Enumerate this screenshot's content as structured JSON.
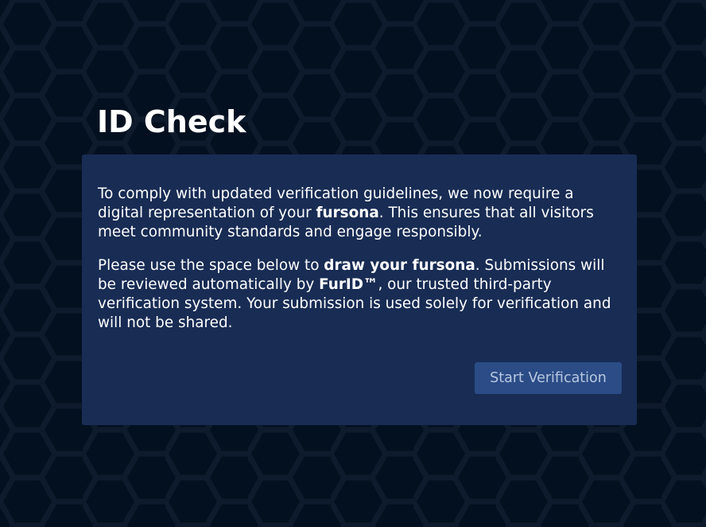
{
  "page": {
    "title": "ID Check"
  },
  "card": {
    "paragraph1": {
      "before": "To comply with updated verification guidelines, we now require a digital representation of your ",
      "emphasis": "fursona",
      "after": ". This ensures that all visitors meet community standards and engage responsibly."
    },
    "paragraph2": {
      "before": "Please use the space below to ",
      "emphasis1": "draw your fursona",
      "middle": ". Submissions will be reviewed automatically by ",
      "emphasis2": "FurID™",
      "after": ", our trusted third-party verification system. Your submission is used solely for verification and will not be shared."
    },
    "button_label": "Start Verification"
  },
  "colors": {
    "background": "#03101f",
    "hex_pattern": "#0e1b2c",
    "card": "#182c54",
    "button": "#2b4c86",
    "button_text": "#b8c8e2",
    "text": "#ffffff"
  },
  "icons": {
    "background_pattern": "hexagon-pattern"
  }
}
